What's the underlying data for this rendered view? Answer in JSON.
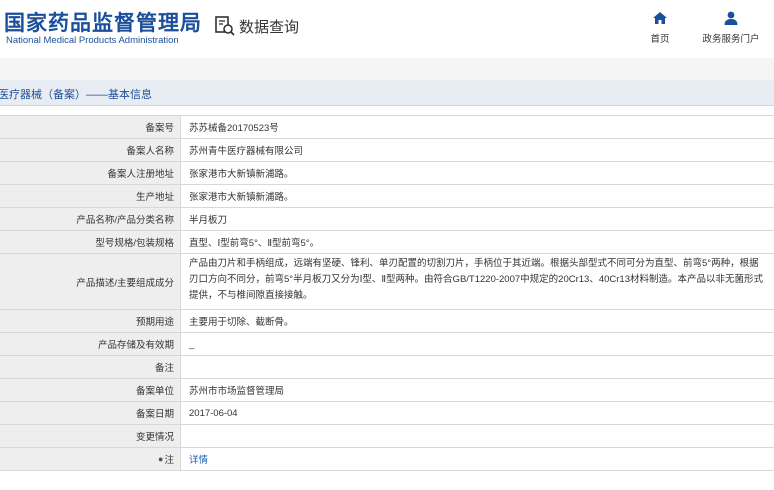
{
  "header": {
    "logo_cn": "国家药品监督管理局",
    "logo_en": "National Medical Products Administration",
    "query_label": "数据查询",
    "nav": {
      "home": "首页",
      "portal": "政务服务门户"
    }
  },
  "section": {
    "title": "医疗器械（备案）——基本信息"
  },
  "rows": [
    {
      "label": "备案号",
      "value": "苏苏械备20170523号"
    },
    {
      "label": "备案人名称",
      "value": "苏州青牛医疗器械有限公司"
    },
    {
      "label": "备案人注册地址",
      "value": "张家港市大新镇新浦路。"
    },
    {
      "label": "生产地址",
      "value": "张家港市大新镇新浦路。"
    },
    {
      "label": "产品名称/产品分类名称",
      "value": "半月板刀"
    },
    {
      "label": "型号规格/包装规格",
      "value": "直型、Ⅰ型前弯5°、Ⅱ型前弯5°。"
    },
    {
      "label": "产品描述/主要组成成分",
      "value": "产品由刀片和手柄组成，远端有坚硬、锋利、单刃配置的切割刀片，手柄位于其近端。根据头部型式不同可分为直型、前弯5°两种，根据刃口方向不同分，前弯5°半月板刀又分为Ⅰ型、Ⅱ型两种。由符合GB/T1220-2007中规定的20Cr13、40Cr13材料制造。本产品以非无菌形式提供，不与椎间隙直接接触。"
    },
    {
      "label": "预期用途",
      "value": "主要用于切除、截断骨。"
    },
    {
      "label": "产品存储及有效期",
      "value": "_"
    },
    {
      "label": "备注",
      "value": ""
    },
    {
      "label": "备案单位",
      "value": "苏州市市场监督管理局"
    },
    {
      "label": "备案日期",
      "value": "2017-06-04"
    },
    {
      "label": "变更情况",
      "value": ""
    },
    {
      "label": "注",
      "value": "详情"
    }
  ],
  "icons": {
    "query": "search-document-icon",
    "home": "home-icon",
    "portal": "user-icon",
    "note": "pin-icon"
  },
  "colors": {
    "brand_blue": "#1a4f9c",
    "link_blue": "#1a5fb4",
    "label_bg": "#eeeeee",
    "section_bg": "#e8edf4"
  }
}
